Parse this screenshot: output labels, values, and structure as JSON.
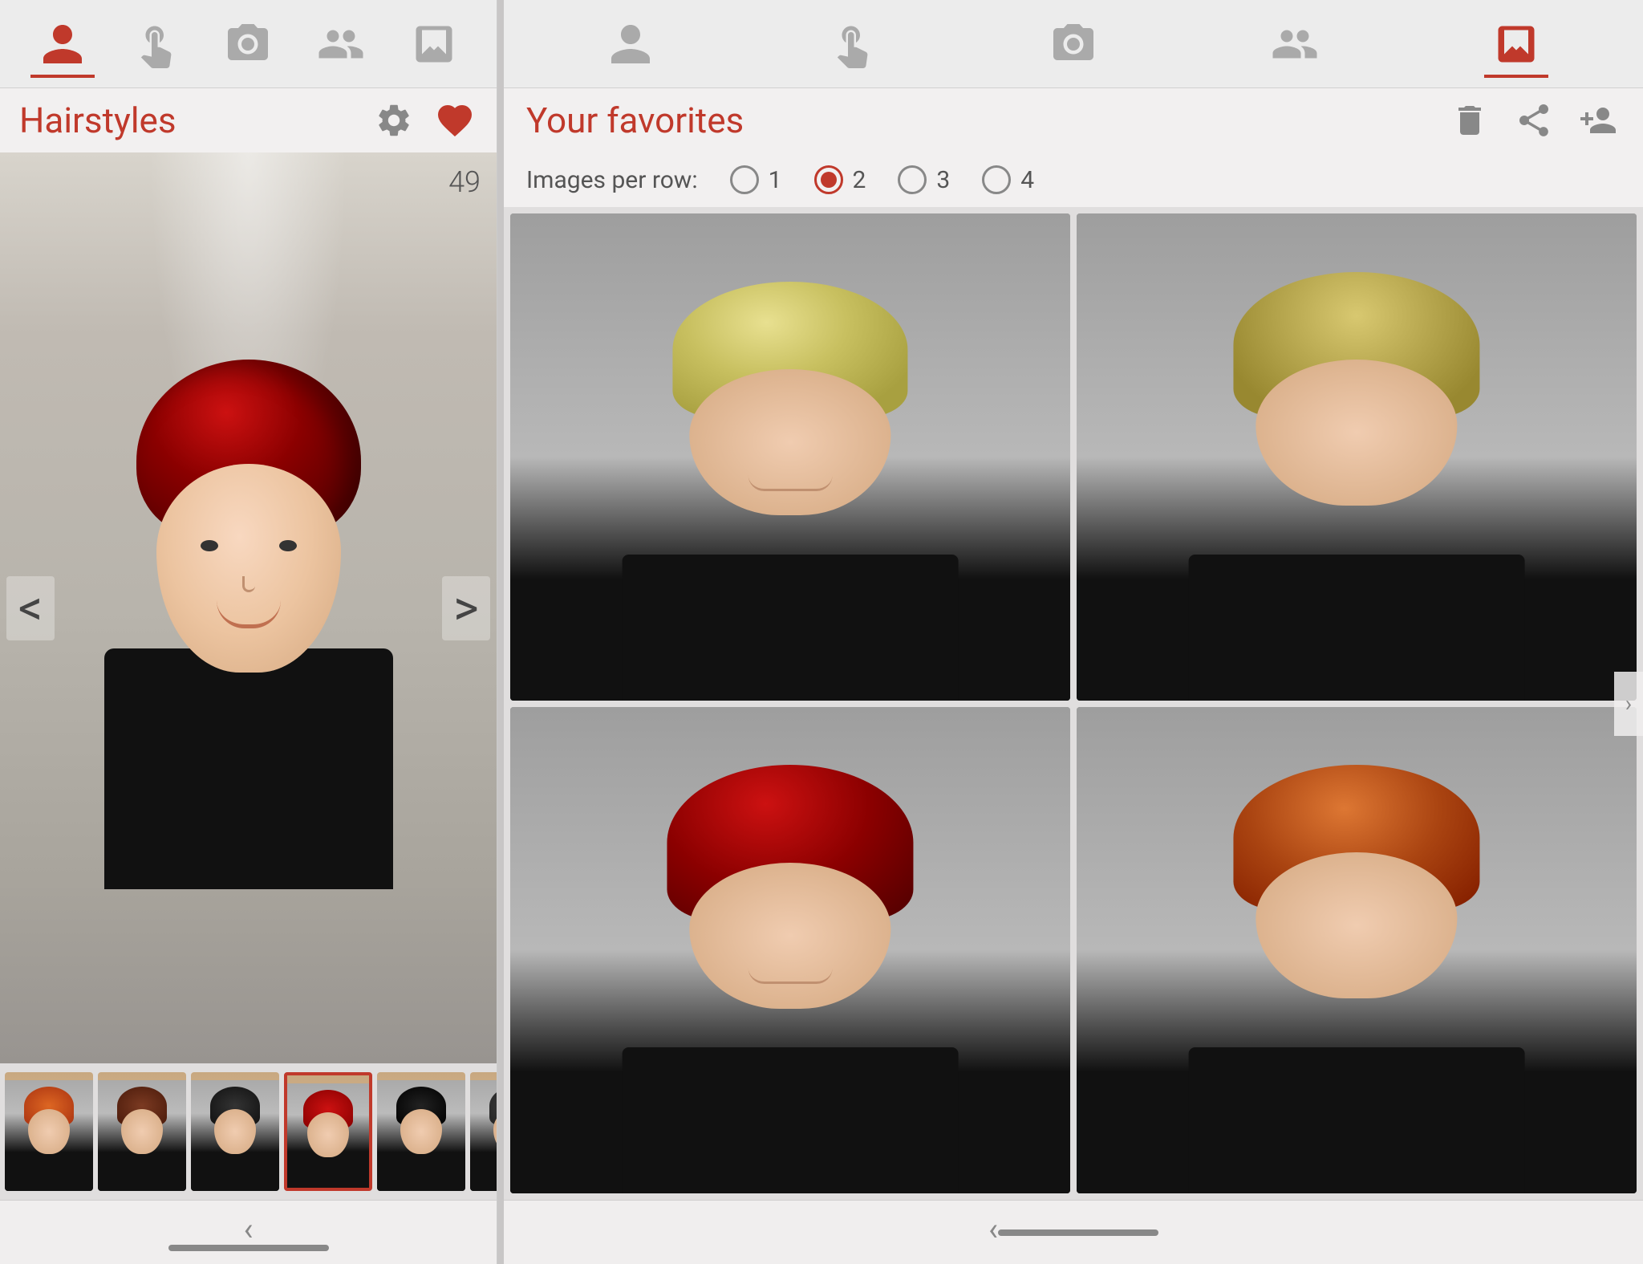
{
  "left_panel": {
    "nav": {
      "items": [
        {
          "id": "profile",
          "label": "Profile",
          "active": true
        },
        {
          "id": "gesture",
          "label": "Gesture",
          "active": false
        },
        {
          "id": "camera",
          "label": "Camera",
          "active": false
        },
        {
          "id": "community",
          "label": "Community",
          "active": false
        },
        {
          "id": "favorites",
          "label": "Favorites",
          "active": false
        }
      ]
    },
    "header": {
      "title": "Hairstyles",
      "settings_label": "Settings",
      "heart_label": "Favorites"
    },
    "image_counter": "49",
    "left_arrow": "<",
    "right_arrow": ">",
    "thumbnails": [
      {
        "id": "thumb-1",
        "hair_color": "orange",
        "selected": false
      },
      {
        "id": "thumb-2",
        "hair_color": "brown",
        "selected": false
      },
      {
        "id": "thumb-3",
        "hair_color": "dark",
        "selected": false
      },
      {
        "id": "thumb-4",
        "hair_color": "red",
        "selected": true
      },
      {
        "id": "thumb-5",
        "hair_color": "black",
        "selected": false
      },
      {
        "id": "thumb-6",
        "hair_color": "dark",
        "selected": false
      }
    ],
    "bottom_nav": {
      "back_arrow": "‹",
      "home_indicator_visible": true
    }
  },
  "right_panel": {
    "nav": {
      "items": [
        {
          "id": "profile",
          "label": "Profile",
          "active": false
        },
        {
          "id": "gesture",
          "label": "Gesture",
          "active": false
        },
        {
          "id": "camera",
          "label": "Camera",
          "active": false
        },
        {
          "id": "community",
          "label": "Community",
          "active": false
        },
        {
          "id": "favorites",
          "label": "Favorites",
          "active": true
        }
      ]
    },
    "header": {
      "title": "Your favorites",
      "trash_label": "Delete",
      "share_label": "Share",
      "person_add_label": "Add person"
    },
    "images_per_row": {
      "label": "Images per row:",
      "options": [
        {
          "value": "1",
          "label": "1",
          "selected": false
        },
        {
          "value": "2",
          "label": "2",
          "selected": true
        },
        {
          "value": "3",
          "label": "3",
          "selected": false
        },
        {
          "value": "4",
          "label": "4",
          "selected": false
        }
      ]
    },
    "grid": {
      "cells": [
        {
          "id": "fav-1",
          "hair_color": "blonde",
          "position": "top-left"
        },
        {
          "id": "fav-2",
          "hair_color": "blonde2",
          "position": "top-right"
        },
        {
          "id": "fav-3",
          "hair_color": "red",
          "position": "bottom-left"
        },
        {
          "id": "fav-4",
          "hair_color": "orange",
          "position": "bottom-right"
        }
      ]
    },
    "bottom_nav": {
      "back_arrow": "‹",
      "home_indicator_visible": true
    }
  },
  "colors": {
    "accent": "#c0392b",
    "nav_icon_active": "#c0392b",
    "nav_icon_inactive": "#aaaaaa",
    "title_color": "#c0392b",
    "bg": "#f2f0f0"
  }
}
